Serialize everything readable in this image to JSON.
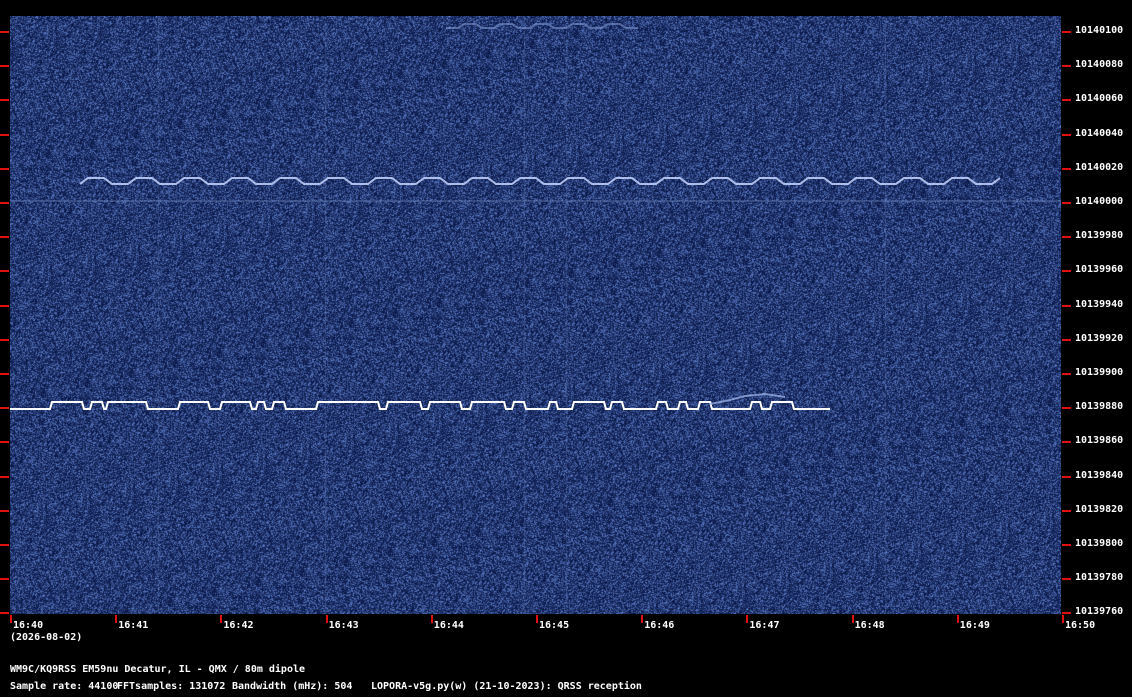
{
  "frequency_axis": {
    "labels": [
      "10140100",
      "10140080",
      "10140060",
      "10140040",
      "10140020",
      "10140000",
      "10139980",
      "10139960",
      "10139940",
      "10139920",
      "10139900",
      "10139880",
      "10139860",
      "10139840",
      "10139820",
      "10139800",
      "10139780",
      "10139760"
    ]
  },
  "time_axis": {
    "labels": [
      "16:40",
      "16:41",
      "16:42",
      "16:43",
      "16:44",
      "16:45",
      "16:46",
      "16:47",
      "16:48",
      "16:49",
      "16:50"
    ],
    "date": "(2026-08-02)"
  },
  "station": {
    "description": "WM9C/KQ9RSS EM59nu Decatur, IL - QMX / 80m dipole"
  },
  "params": {
    "sample_rate": "Sample rate: 44100",
    "fft_samples": "FFTsamples: 131072",
    "bandwidth": "Bandwidth (mHz): 504",
    "software": "LOPORA-v5g.py(w) (21-10-2023): QRSS reception"
  },
  "colors": {
    "background": "#000000",
    "waterfall_base": "#0a1a4a",
    "signal": "#ffffff",
    "tick": "#e01010"
  }
}
